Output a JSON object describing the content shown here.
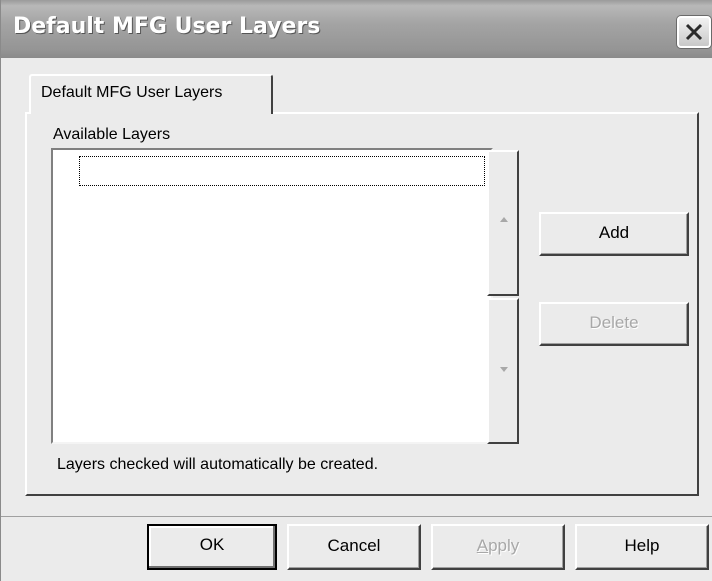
{
  "window": {
    "title": "Default MFG User Layers"
  },
  "tabs": [
    {
      "label": "Default MFG User Layers",
      "selected": true
    }
  ],
  "panel": {
    "group_label": "Available Layers",
    "list_items": [
      ""
    ],
    "note": "Layers checked will automatically be created."
  },
  "side_buttons": {
    "add_label": "Add",
    "delete_label": "Delete",
    "delete_enabled": false
  },
  "footer": {
    "ok_label": "OK",
    "cancel_label": "Cancel",
    "apply_label_first": "A",
    "apply_label_rest": "pply",
    "apply_enabled": false,
    "help_label": "Help"
  },
  "icons": {
    "close": "close-icon",
    "scroll_up": "arrow-up-icon",
    "scroll_down": "arrow-down-icon"
  },
  "colors": {
    "dialog_bg": "#ebebeb",
    "titlebar": "#a4a4a4",
    "disabled_text": "#a8a8a8"
  }
}
